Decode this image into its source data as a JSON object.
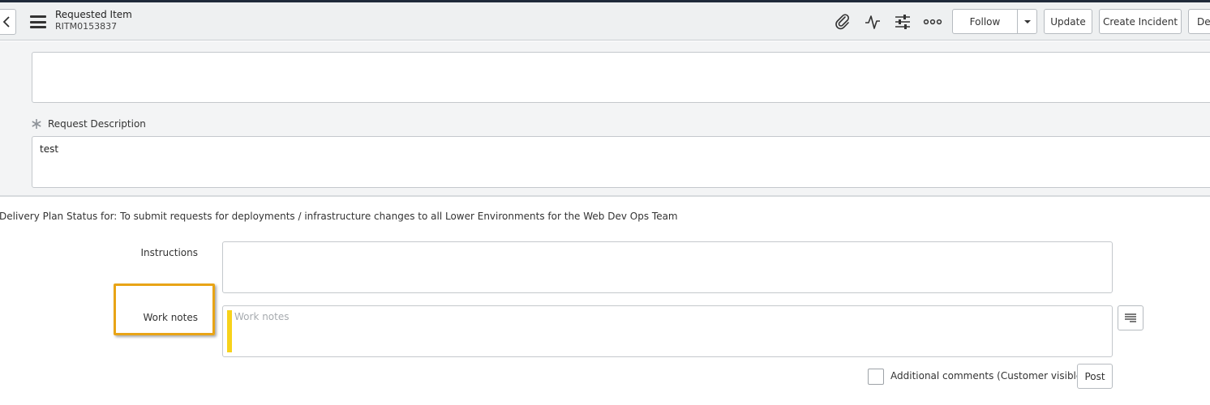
{
  "header": {
    "record_type": "Requested Item",
    "record_number": "RITM0153837",
    "icons": [
      "paperclip-icon",
      "activity-icon",
      "settings-sliders-icon",
      "more-options-icon"
    ],
    "buttons": {
      "follow": "Follow",
      "update": "Update",
      "create_incident": "Create Incident",
      "delete": "Delete"
    }
  },
  "form": {
    "request_description": {
      "label": "Request Description",
      "value": "test"
    }
  },
  "delivery_plan": {
    "title": "Delivery Plan Status for: To submit requests for deployments / infrastructure changes to all Lower Environments for the Web Dev Ops Team"
  },
  "instructions": {
    "label": "Instructions"
  },
  "work_notes": {
    "label": "Work notes",
    "placeholder": "Work notes"
  },
  "additional_comments": {
    "label": "Additional comments (Customer visible)"
  },
  "post_button": "Post",
  "colors": {
    "highlight": "#e8a416",
    "work_notes_bar": "#f7d21b",
    "top_strip": "#1f2a3a"
  }
}
